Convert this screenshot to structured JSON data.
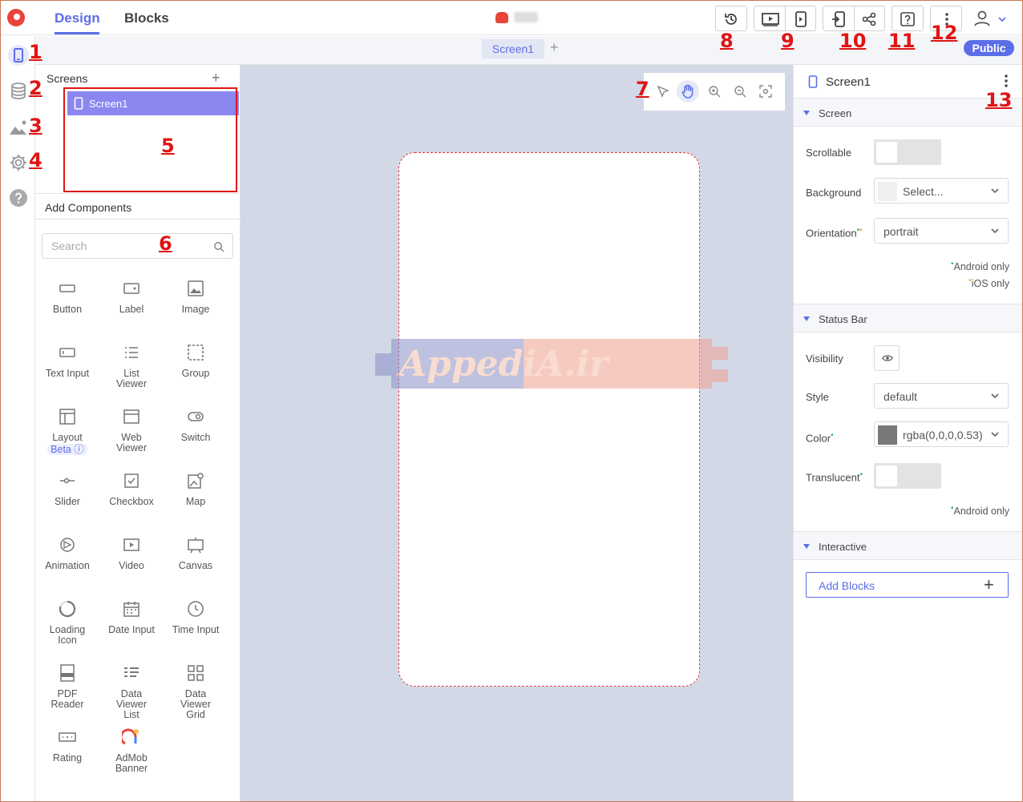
{
  "app": {
    "tabs": [
      "Design",
      "Blocks"
    ],
    "active_tab": "Design",
    "public_badge": "Public"
  },
  "toolbar": {
    "screen_tab": "Screen1",
    "add_screen": "+"
  },
  "screens_panel": {
    "title": "Screens",
    "add": "+",
    "items": [
      "Screen1"
    ]
  },
  "components": {
    "title": "Add Components",
    "search_placeholder": "Search",
    "items": [
      {
        "label": "Button",
        "icon": "button-icon"
      },
      {
        "label": "Label",
        "icon": "label-icon"
      },
      {
        "label": "Image",
        "icon": "image-icon"
      },
      {
        "label": "Text Input",
        "icon": "text-input-icon"
      },
      {
        "label": "List Viewer",
        "icon": "list-icon"
      },
      {
        "label": "Group",
        "icon": "group-icon"
      },
      {
        "label": "Layout",
        "badge": "Beta",
        "icon": "layout-icon"
      },
      {
        "label": "Web Viewer",
        "icon": "web-viewer-icon"
      },
      {
        "label": "Switch",
        "icon": "switch-icon"
      },
      {
        "label": "Slider",
        "icon": "slider-icon"
      },
      {
        "label": "Checkbox",
        "icon": "checkbox-icon"
      },
      {
        "label": "Map",
        "icon": "map-icon"
      },
      {
        "label": "Animation",
        "icon": "animation-icon"
      },
      {
        "label": "Video",
        "icon": "video-icon"
      },
      {
        "label": "Canvas",
        "icon": "canvas-icon"
      },
      {
        "label": "Loading Icon",
        "icon": "loading-icon"
      },
      {
        "label": "Date Input",
        "icon": "date-icon"
      },
      {
        "label": "Time Input",
        "icon": "time-icon"
      },
      {
        "label": "PDF Reader",
        "icon": "pdf-icon"
      },
      {
        "label": "Data Viewer List",
        "icon": "data-list-icon"
      },
      {
        "label": "Data Viewer Grid",
        "icon": "data-grid-icon"
      },
      {
        "label": "Rating",
        "icon": "rating-icon"
      },
      {
        "label": "AdMob Banner",
        "icon": "admob-icon"
      }
    ]
  },
  "canvas": {
    "watermark": "AppediA.ir"
  },
  "properties": {
    "title": "Screen1",
    "screen_section": "Screen",
    "scrollable_label": "Scrollable",
    "background_label": "Background",
    "background_value": "Select...",
    "orientation_label": "Orientation",
    "orientation_value": "portrait",
    "android_only": "Android only",
    "ios_only": "iOS only",
    "statusbar_section": "Status Bar",
    "visibility_label": "Visibility",
    "style_label": "Style",
    "style_value": "default",
    "color_label": "Color",
    "color_value": "rgba(0,0,0,0.53)",
    "translucent_label": "Translucent",
    "android_only_2": "Android only",
    "interactive_section": "Interactive",
    "add_blocks": "Add Blocks",
    "add_blocks_plus": "+"
  },
  "annotations": [
    "1",
    "2",
    "3",
    "4",
    "5",
    "6",
    "7",
    "8",
    "9",
    "10",
    "11",
    "12",
    "13"
  ],
  "colors": {
    "accent": "#5b6ee8",
    "selected_screen": "#8b87f1",
    "annotation": "#e01414",
    "canvas_bg": "#d3d8e6"
  }
}
